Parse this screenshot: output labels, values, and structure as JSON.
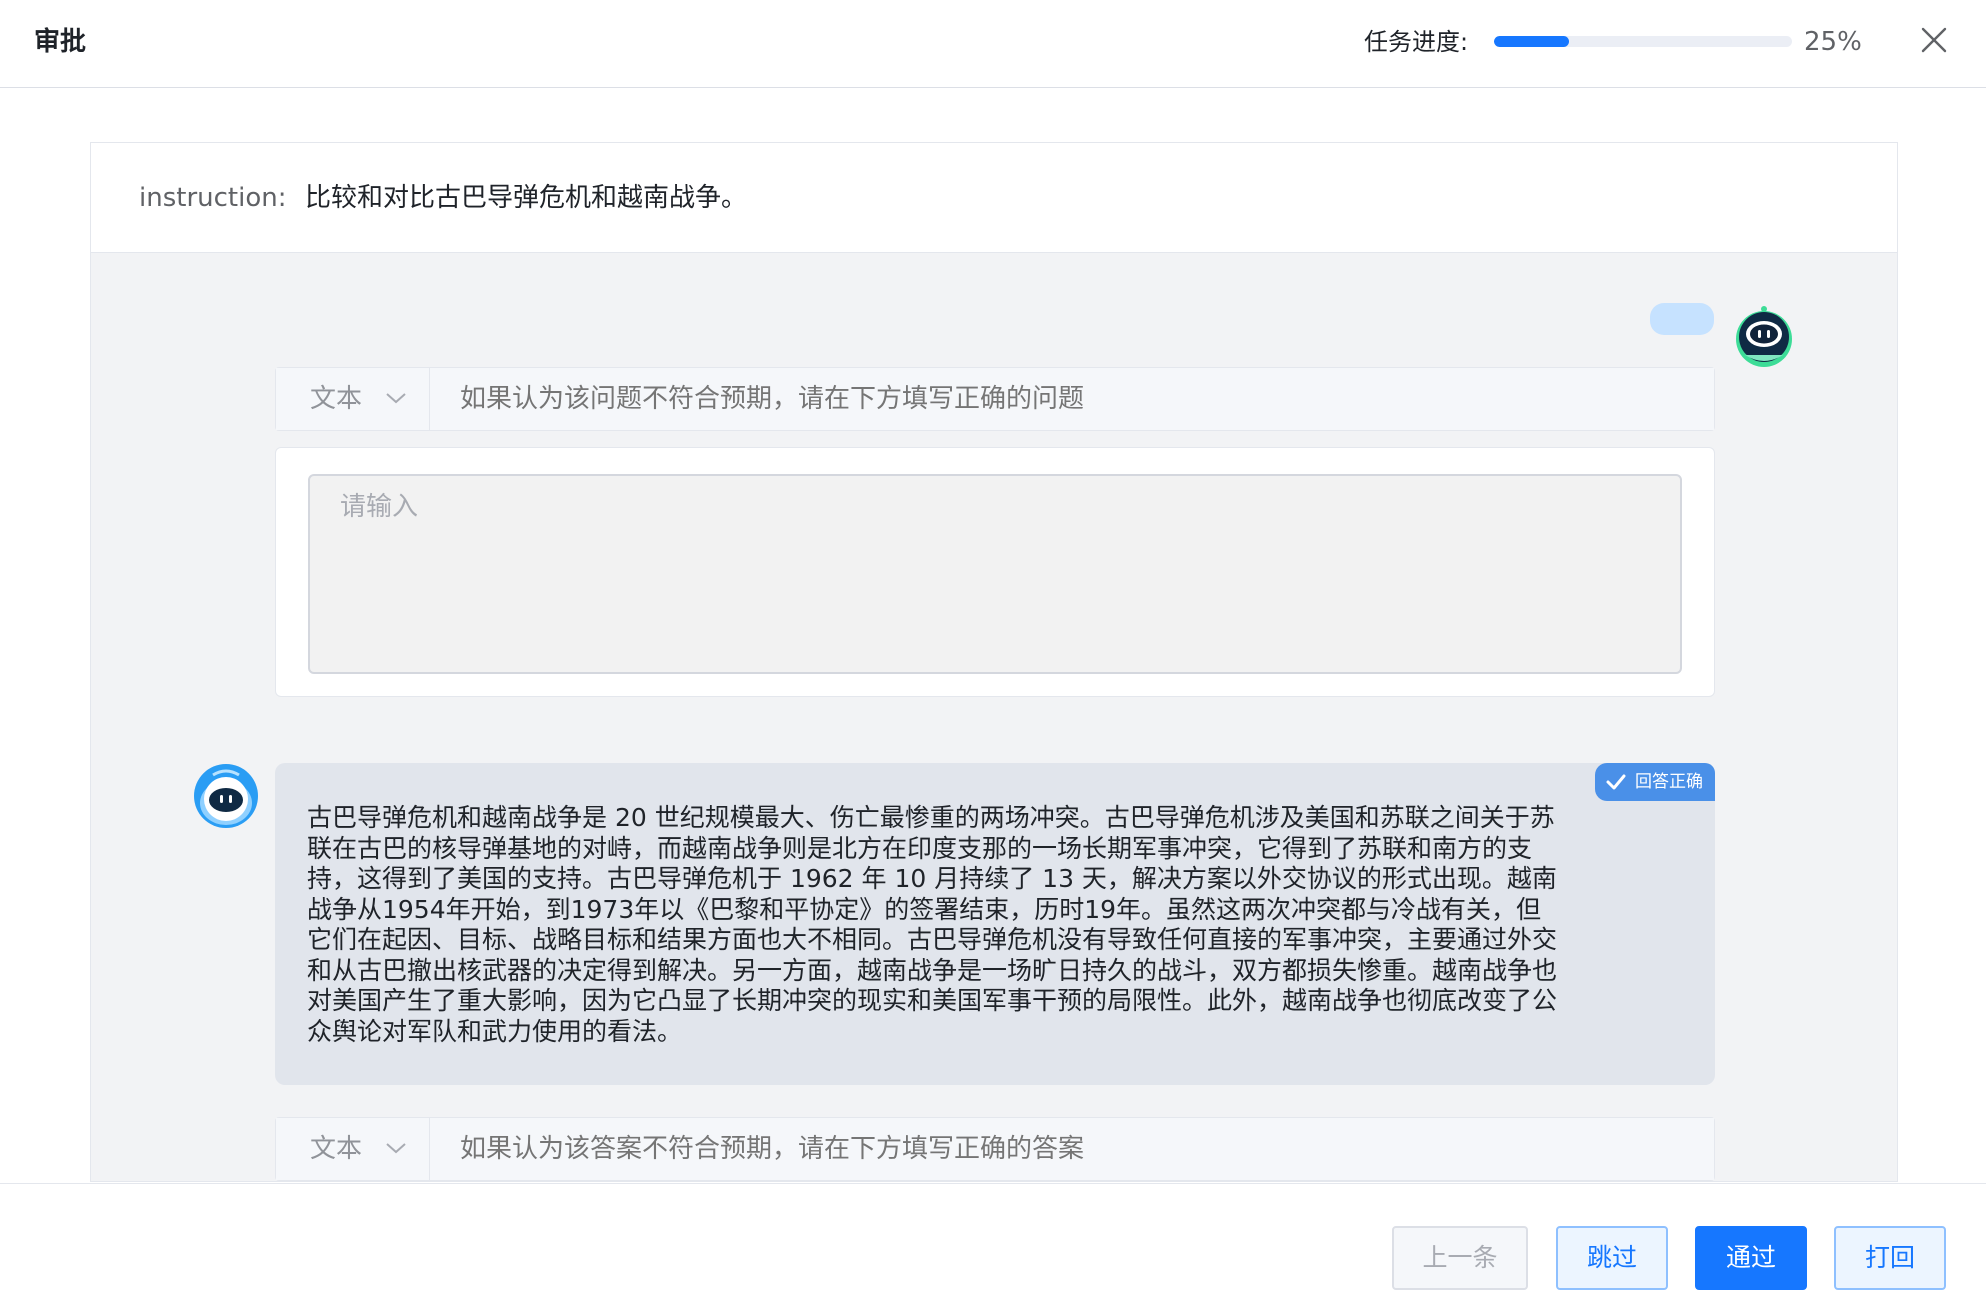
{
  "header": {
    "title": "审批",
    "progress_label": "任务进度:",
    "progress_fraction": 0.25,
    "progress_text": "25%"
  },
  "instruction": {
    "label": "instruction:",
    "text": "比较和对比古巴导弹危机和越南战争。"
  },
  "question_section": {
    "type_select": "文本",
    "hint": "如果认为该问题不符合预期，请在下方填写正确的问题",
    "input_placeholder": "请输入"
  },
  "answer_section": {
    "badge": "回答正确",
    "text": "古巴导弹危机和越南战争是 20 世纪规模最大、伤亡最惨重的两场冲突。古巴导弹危机涉及美国和苏联之间关于苏联在古巴的核导弹基地的对峙，而越南战争则是北方在印度支那的一场长期军事冲突，它得到了苏联和南方的支持，这得到了美国的支持。古巴导弹危机于 1962 年 10 月持续了 13 天，解决方案以外交协议的形式出现。越南战争从1954年开始，到1973年以《巴黎和平协定》的签署结束，历时19年。虽然这两次冲突都与冷战有关，但它们在起因、目标、战略目标和结果方面也大不相同。古巴导弹危机没有导致任何直接的军事冲突，主要通过外交和从古巴撤出核武器的决定得到解决。另一方面，越南战争是一场旷日持久的战斗，双方都损失惨重。越南战争也对美国产生了重大影响，因为它凸显了长期冲突的现实和美国军事干预的局限性。此外，越南战争也彻底改变了公众舆论对军队和武力使用的看法。",
    "type_select": "文本",
    "hint": "如果认为该答案不符合预期，请在下方填写正确的答案"
  },
  "footer": {
    "prev_label": "上一条",
    "skip_label": "跳过",
    "pass_label": "通过",
    "reject_label": "打回"
  },
  "colors": {
    "accent": "#1677ff",
    "bot_avatar": "#2a9df4",
    "user_avatar_ring": "#3ddc97",
    "badge": "#4a90e8"
  },
  "icons": {
    "close": "close-icon",
    "chevron": "chevron-down-icon",
    "check": "check-icon",
    "bot": "robot-avatar"
  }
}
